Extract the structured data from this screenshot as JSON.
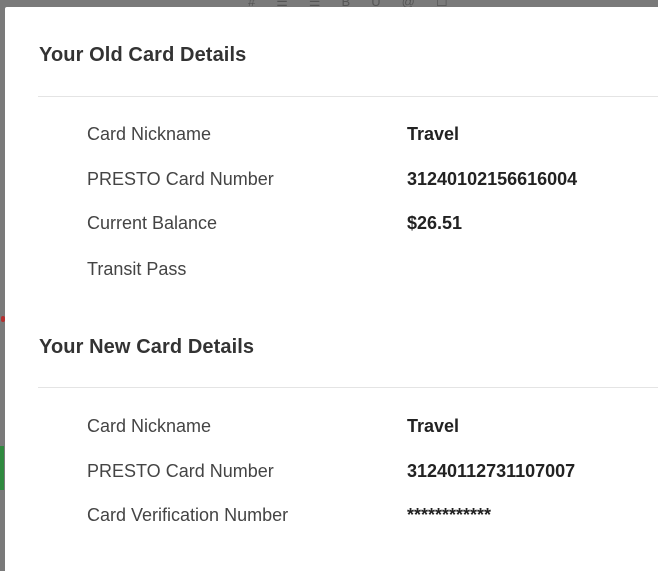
{
  "background": {
    "toolbar_glyphs": [
      "#",
      "☰",
      "☰",
      "B",
      "U",
      "@",
      "☐"
    ]
  },
  "old_card": {
    "title": "Your Old Card Details",
    "rows": [
      {
        "label": "Card Nickname",
        "value": "Travel"
      },
      {
        "label": "PRESTO Card Number",
        "value": "31240102156616004"
      },
      {
        "label": "Current Balance",
        "value": "$26.51"
      },
      {
        "label": "Transit Pass",
        "value": ""
      }
    ]
  },
  "new_card": {
    "title": "Your New Card Details",
    "rows": [
      {
        "label": "Card Nickname",
        "value": "Travel"
      },
      {
        "label": "PRESTO Card Number",
        "value": "31240112731107007"
      },
      {
        "label": "Card Verification Number",
        "value": "************"
      }
    ]
  }
}
